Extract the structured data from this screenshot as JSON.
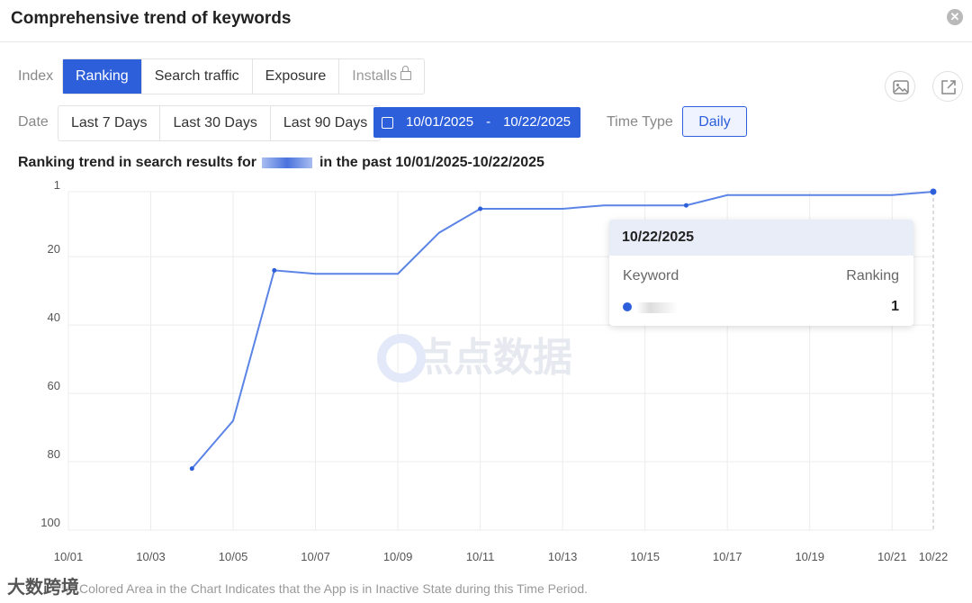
{
  "dialog": {
    "title": "Comprehensive trend of keywords",
    "close_icon": "close-icon"
  },
  "index_row": {
    "label": "Index",
    "options": [
      "Ranking",
      "Search traffic",
      "Exposure",
      "Installs"
    ],
    "active": "Ranking",
    "locked": "Installs"
  },
  "date_row": {
    "label": "Date",
    "options": [
      "Last 7 Days",
      "Last 30 Days",
      "Last 90 Days"
    ],
    "range_start": "10/01/2025",
    "range_sep": "-",
    "range_end": "10/22/2025"
  },
  "time_type": {
    "label": "Time Type",
    "value": "Daily"
  },
  "toolbar": {
    "image_icon": "image-download-icon",
    "export_icon": "external-link-icon"
  },
  "subtitle": {
    "prefix": "Ranking trend in search results for",
    "suffix": "in the past 10/01/2025-10/22/2025"
  },
  "tooltip": {
    "date": "10/22/2025",
    "col_keyword": "Keyword",
    "col_ranking": "Ranking",
    "value": "1"
  },
  "watermark": {
    "text": "点点数据"
  },
  "corner_watermark": "大数跨境",
  "footer": "The Colored Area in the Chart Indicates that the App is in Inactive State during this Time Period.",
  "colors": {
    "accent": "#2d5fdb",
    "line": "#5b84e6"
  },
  "chart_data": {
    "type": "line",
    "y_inverted": true,
    "ylim": [
      1,
      100
    ],
    "yticks": [
      "1",
      "20",
      "40",
      "60",
      "80",
      "100"
    ],
    "ytick_values": [
      1,
      20,
      40,
      60,
      80,
      100
    ],
    "xticks": [
      "10/01",
      "10/03",
      "10/05",
      "10/07",
      "10/09",
      "10/11",
      "10/13",
      "10/15",
      "10/17",
      "10/19",
      "10/21",
      "10/22"
    ],
    "xtick_days": [
      1,
      3,
      5,
      7,
      9,
      11,
      13,
      15,
      17,
      19,
      21,
      22
    ],
    "series": [
      {
        "x": [
          4,
          5,
          6,
          7,
          8,
          9,
          10,
          11,
          12,
          13,
          14,
          15,
          16,
          17,
          18,
          19,
          20,
          21,
          22
        ],
        "values": [
          82,
          68,
          24,
          25,
          25,
          25,
          13,
          6,
          6,
          6,
          5,
          5,
          5,
          2,
          2,
          2,
          2,
          2,
          1
        ]
      }
    ]
  }
}
